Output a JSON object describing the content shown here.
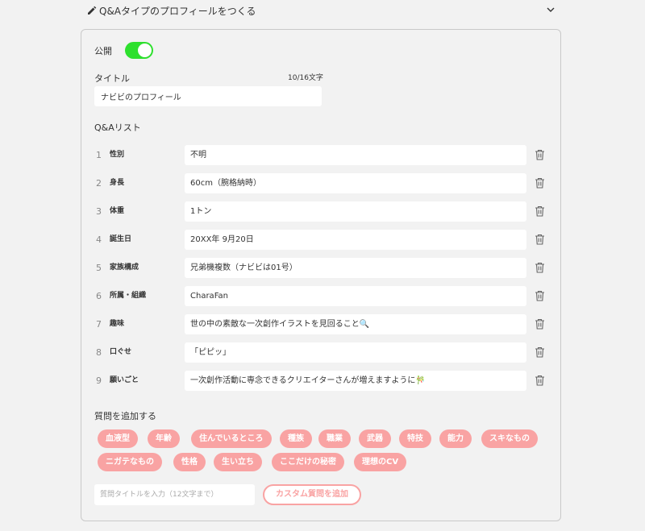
{
  "header": {
    "title": "Q&Aタイプのプロフィールをつくる"
  },
  "public": {
    "label": "公開",
    "on": true
  },
  "title_field": {
    "label": "タイトル",
    "counter": "10/16文字",
    "value": "ナビビのプロフィール"
  },
  "qa": {
    "label": "Q&Aリスト",
    "items": [
      {
        "num": "1",
        "key": "性別",
        "value": "不明"
      },
      {
        "num": "2",
        "key": "身長",
        "value": "60cm（腕格納時）"
      },
      {
        "num": "3",
        "key": "体重",
        "value": "1トン"
      },
      {
        "num": "4",
        "key": "誕生日",
        "value": "20XX年 9月20日"
      },
      {
        "num": "5",
        "key": "家族構成",
        "value": "兄弟機複数（ナビビは01号）"
      },
      {
        "num": "6",
        "key": "所属・組織",
        "value": "CharaFan"
      },
      {
        "num": "7",
        "key": "趣味",
        "value": "世の中の素敵な一次創作イラストを見回ること🔍"
      },
      {
        "num": "8",
        "key": "口ぐせ",
        "value": "「ピピッ」"
      },
      {
        "num": "9",
        "key": "願いごと",
        "value": "一次創作活動に専念できるクリエイターさんが増えますように🎋"
      }
    ]
  },
  "add": {
    "label": "質問を追加する",
    "chips": [
      "血液型",
      "年齢",
      "住んでいるところ",
      "種族",
      "職業",
      "武器",
      "特技",
      "能力",
      "スキなもの",
      "ニガテなもの",
      "性格",
      "生い立ち",
      "ここだけの秘密",
      "理想のCV"
    ],
    "custom_placeholder": "質問タイトルを入力（12文字まで）",
    "custom_button": "カスタム質問を追加"
  },
  "colors": {
    "toggle": "#2ee02e",
    "chip": "#f9a3a3",
    "background": "#f2f2f2"
  },
  "icons": {
    "edit": "pencil-icon",
    "collapse": "chevron-down-icon",
    "delete": "trash-icon"
  }
}
